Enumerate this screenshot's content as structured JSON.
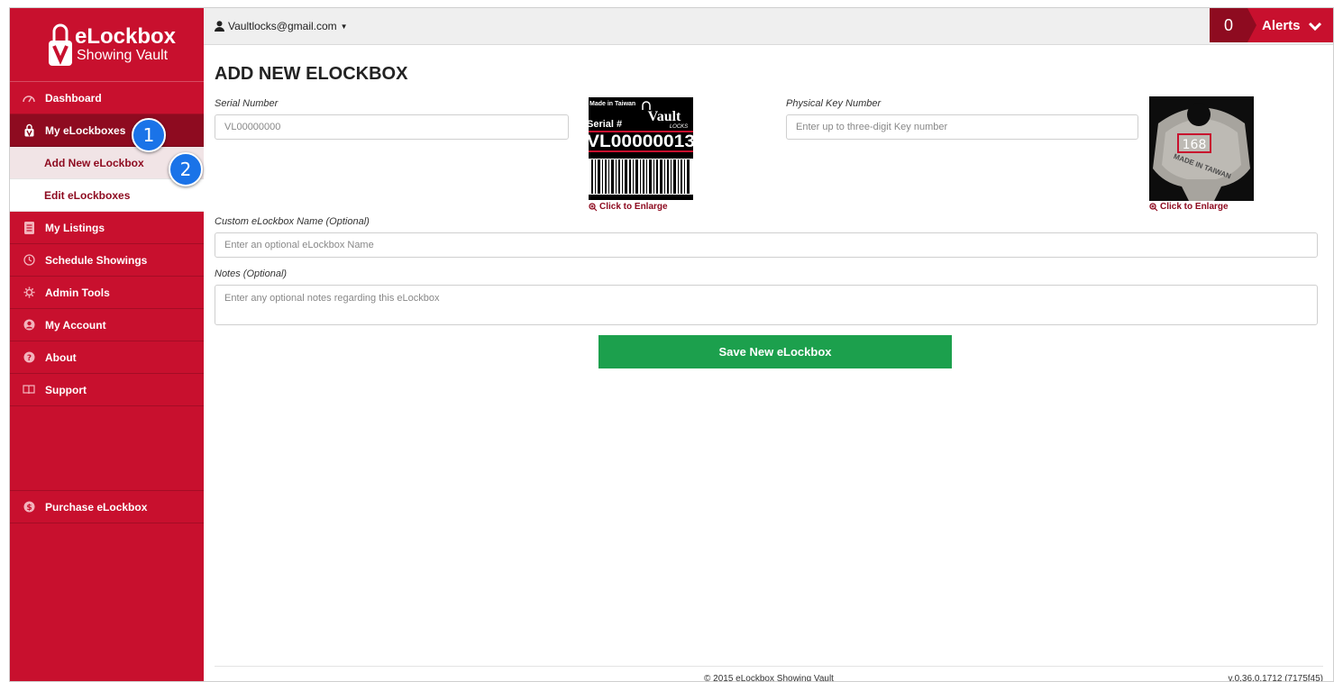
{
  "brand": {
    "name": "eLockbox",
    "tagline": "Showing Vault"
  },
  "topbar": {
    "user_email": "Vaultlocks@gmail.com",
    "alerts_count": "0",
    "alerts_label": "Alerts"
  },
  "sidebar": {
    "items": [
      {
        "label": "Dashboard",
        "icon": "dashboard-icon"
      },
      {
        "label": "My eLockboxes",
        "icon": "lock-icon"
      },
      {
        "label": "My Listings",
        "icon": "listings-icon"
      },
      {
        "label": "Schedule Showings",
        "icon": "clock-icon"
      },
      {
        "label": "Admin Tools",
        "icon": "gear-icon"
      },
      {
        "label": "My Account",
        "icon": "user-icon"
      },
      {
        "label": "About",
        "icon": "question-icon"
      },
      {
        "label": "Support",
        "icon": "book-icon"
      },
      {
        "label": "Purchase eLockbox",
        "icon": "dollar-icon"
      }
    ],
    "subitems": [
      {
        "label": "Add New eLockbox"
      },
      {
        "label": "Edit eLockboxes"
      }
    ],
    "callouts": [
      "1",
      "2"
    ]
  },
  "form": {
    "title": "ADD NEW ELOCKBOX",
    "serial_label": "Serial Number",
    "serial_value": "VL00000000",
    "key_label": "Physical Key Number",
    "key_placeholder": "Enter up to three-digit Key number",
    "name_label": "Custom eLockbox Name (Optional)",
    "name_placeholder": "Enter an optional eLockbox Name",
    "notes_label": "Notes (Optional)",
    "notes_placeholder": "Enter any optional notes regarding this eLockbox",
    "enlarge_label": "Click to Enlarge",
    "save_label": "Save New eLockbox"
  },
  "serial_image": {
    "made_in": "Made in Taiwan",
    "serial_prefix": "Serial #",
    "brand_word": "Vault",
    "brand_sub": "LOCKS",
    "serial_code": "VL00000013"
  },
  "key_image": {
    "key_number": "168",
    "stamp": "MADE IN TAIWAN"
  },
  "footer": {
    "copyright": "© 2015 eLockbox Showing Vault",
    "version": "v.0.36.0.1712 (7175f45)"
  },
  "colors": {
    "brand_red": "#c8102e",
    "dark_red": "#8e0b20",
    "save_green": "#1ca04d",
    "callout_blue": "#1a73e8"
  }
}
